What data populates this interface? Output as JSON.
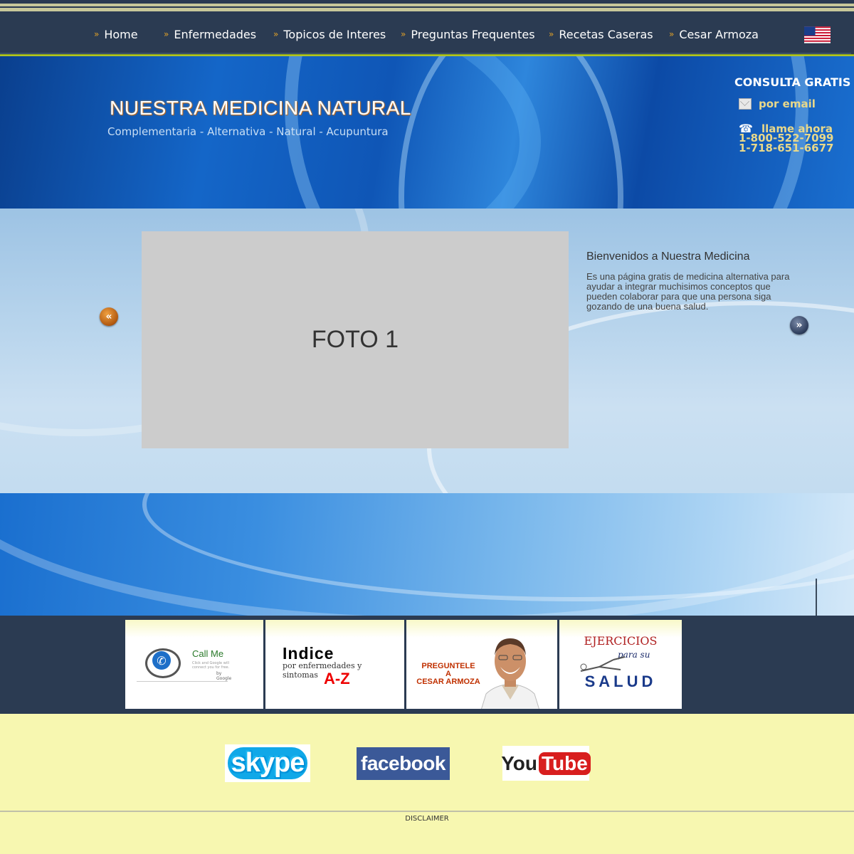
{
  "nav": {
    "items": [
      {
        "label": "Home"
      },
      {
        "label": "Enfermedades"
      },
      {
        "label": "Topicos de Interes"
      },
      {
        "label": "Preguntas Frequentes"
      },
      {
        "label": "Recetas Caseras"
      },
      {
        "label": "Cesar Armoza"
      }
    ],
    "flag_icon": "us-flag-icon",
    "arrow_icon": "double-chevron-right-icon",
    "arrow_glyph": "»",
    "arrow_color": "#e0a028"
  },
  "header": {
    "title": "NUESTRA MEDICINA NATURAL",
    "subtitle": "Complementaria - Alternativa - Natural - Acupuntura",
    "consulta": "CONSULTA GRATIS",
    "email_label": "por email",
    "llame_label": "llame ahora",
    "phone1": "1-800-522-7099",
    "phone2": "1-718-651-6677",
    "accent_color": "#e8d88a"
  },
  "slider": {
    "photo_label": "FOTO 1",
    "title": "Bienvenidos a Nuestra Medicina",
    "text": "Es una página gratis de medicina alternativa para ayudar a integrar muchisimos conceptos que pueden colaborar para que una persona siga gozando de una buena salud.",
    "prev_glyph": "«",
    "next_glyph": "»"
  },
  "banners": {
    "callme": {
      "title": "Call Me",
      "small": "Click and Google will connect you for free.",
      "by": "by Google"
    },
    "indice": {
      "title": "Indice",
      "sub": "por enfermedades y sintomas",
      "az": "A-Z"
    },
    "preguntele": {
      "line1": "PREGUNTELE",
      "line2": "A",
      "line3": "CESAR ARMOZA"
    },
    "ejercicios": {
      "title": "EJERCICIOS",
      "para": "para su",
      "salud": "SALUD"
    }
  },
  "social": {
    "skype": "skype",
    "facebook": "facebook",
    "youtube_you": "You",
    "youtube_tube": "Tube"
  },
  "footer": {
    "disclaimer": "DISCLAIMER"
  }
}
